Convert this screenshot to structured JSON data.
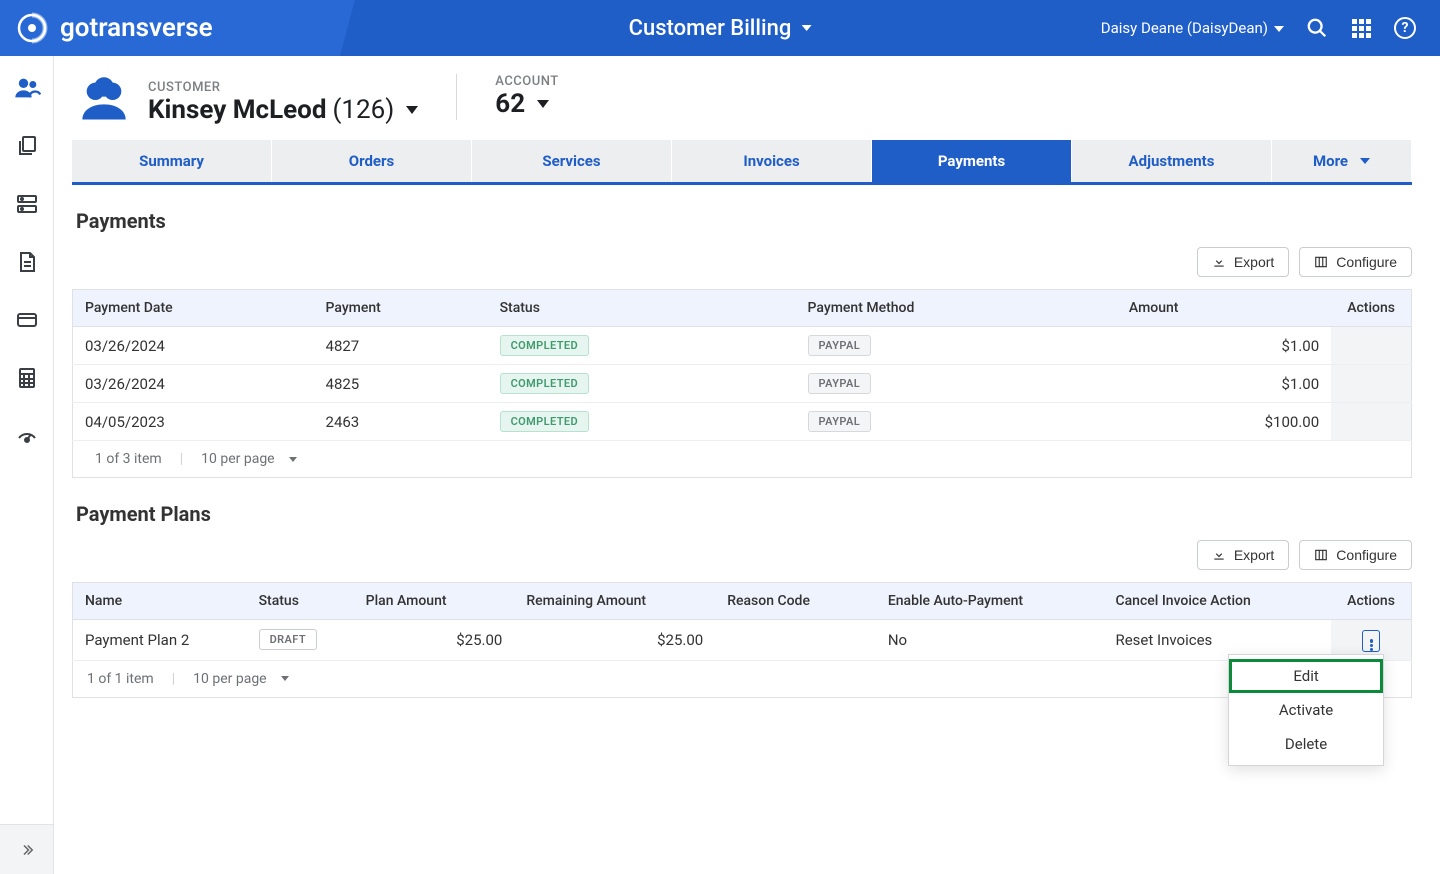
{
  "header": {
    "brand": "gotransverse",
    "title": "Customer Billing",
    "user": "Daisy Deane (DaisyDean)"
  },
  "customer": {
    "eyebrow": "CUSTOMER",
    "name": "Kinsey McLeod",
    "number": "(126)"
  },
  "account": {
    "eyebrow": "ACCOUNT",
    "number": "62"
  },
  "tabs": [
    "Summary",
    "Orders",
    "Services",
    "Invoices",
    "Payments",
    "Adjustments",
    "More"
  ],
  "active_tab_index": 4,
  "buttons": {
    "export": "Export",
    "configure": "Configure"
  },
  "payments": {
    "title": "Payments",
    "columns": [
      "Payment Date",
      "Payment",
      "Status",
      "Payment Method",
      "Amount",
      "Actions"
    ],
    "rows": [
      {
        "date": "03/26/2024",
        "payment": "4827",
        "status": "COMPLETED",
        "method": "PAYPAL",
        "amount": "$1.00"
      },
      {
        "date": "03/26/2024",
        "payment": "4825",
        "status": "COMPLETED",
        "method": "PAYPAL",
        "amount": "$1.00"
      },
      {
        "date": "04/05/2023",
        "payment": "2463",
        "status": "COMPLETED",
        "method": "PAYPAL",
        "amount": "$100.00"
      }
    ],
    "footer": {
      "count": "1 of 3 item",
      "perpage": "10 per page"
    }
  },
  "plans": {
    "title": "Payment Plans",
    "columns": [
      "Name",
      "Status",
      "Plan Amount",
      "Remaining Amount",
      "Reason Code",
      "Enable Auto-Payment",
      "Cancel Invoice Action",
      "Actions"
    ],
    "rows": [
      {
        "name": "Payment Plan 2",
        "status": "DRAFT",
        "plan_amount": "$25.00",
        "remaining": "$25.00",
        "reason": "",
        "auto": "No",
        "cancel": "Reset Invoices"
      }
    ],
    "footer": {
      "count": "1 of 1 item",
      "perpage": "10 per page"
    },
    "menu": [
      "Edit",
      "Activate",
      "Delete"
    ]
  }
}
